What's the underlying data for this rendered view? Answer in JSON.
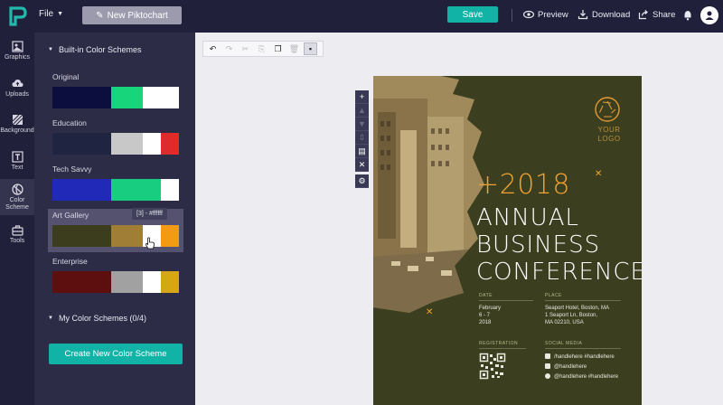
{
  "topbar": {
    "file_label": "File",
    "new_label": "New Piktochart",
    "save_label": "Save",
    "preview_label": "Preview",
    "download_label": "Download",
    "share_label": "Share"
  },
  "rail": {
    "items": [
      {
        "label": "Graphics",
        "icon": "graphics-icon"
      },
      {
        "label": "Uploads",
        "icon": "upload-cloud-icon"
      },
      {
        "label": "Background",
        "icon": "background-icon"
      },
      {
        "label": "Text",
        "icon": "text-icon"
      },
      {
        "label": "Color Scheme",
        "icon": "color-scheme-icon"
      },
      {
        "label": "Tools",
        "icon": "tools-icon"
      }
    ],
    "active": "Color Scheme"
  },
  "panel": {
    "builtin_heading": "Built-in Color Schemes",
    "schemes": [
      {
        "name": "Original",
        "colors": [
          "#0c0f3d",
          "#17d57a",
          "#ffffff",
          "#ffffff"
        ]
      },
      {
        "name": "Education",
        "colors": [
          "#1f2540",
          "#c8c8c8",
          "#ffffff",
          "#e12a2a"
        ]
      },
      {
        "name": "Tech Savvy",
        "colors": [
          "#2029b8",
          "#18cc80",
          "#18cc80",
          "#ffffff"
        ]
      },
      {
        "name": "Art Gallery",
        "colors": [
          "#3b3d1d",
          "#a07e35",
          "#ffffff",
          "#f29a13"
        ]
      },
      {
        "name": "Enterprise",
        "colors": [
          "#5d0f0f",
          "#a1a1a1",
          "#ffffff",
          "#d4a713"
        ]
      }
    ],
    "selected_scheme": "Art Gallery",
    "tooltip": "[3] - #ffffff",
    "my_schemes_heading": "My Color Schemes (0/4)",
    "create_label": "Create New Color Scheme"
  },
  "poster": {
    "logo_text": [
      "YOUR",
      "LOGO"
    ],
    "year": "+2018",
    "title_lines": [
      "ANNUAL",
      "BUSINESS",
      "CONFERENCE"
    ],
    "date_label": "DATE",
    "date_lines": [
      "February",
      "6 - 7",
      "2018"
    ],
    "place_label": "PLACE",
    "place_lines": [
      "Seaport Hotel, Boston, MA",
      "1 Seaport Ln, Boston,",
      "MA 02210, USA"
    ],
    "registration_label": "REGISTRATION",
    "social_label": "SOCIAL MEDIA",
    "social_lines": [
      "/handlehere #handlehere",
      "@handlehere",
      "@handlehere #handlehere"
    ],
    "colors": {
      "background": "#3c3f1f",
      "accent": "#f2a230",
      "text": "#ffffff"
    }
  }
}
